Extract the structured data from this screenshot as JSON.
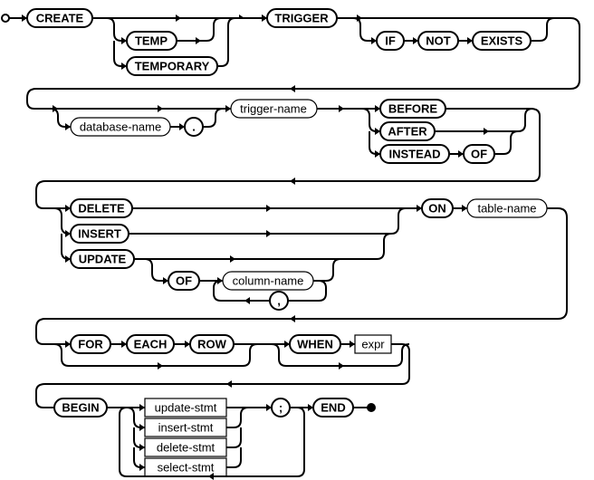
{
  "diagram": {
    "name": "create-trigger-stmt",
    "type": "railroad-syntax-diagram",
    "keywords": {
      "CREATE": "CREATE",
      "TEMP": "TEMP",
      "TEMPORARY": "TEMPORARY",
      "TRIGGER": "TRIGGER",
      "IF": "IF",
      "NOT": "NOT",
      "EXISTS": "EXISTS",
      "BEFORE": "BEFORE",
      "AFTER": "AFTER",
      "INSTEAD": "INSTEAD",
      "OF": "OF",
      "DELETE": "DELETE",
      "INSERT": "INSERT",
      "UPDATE": "UPDATE",
      "ON": "ON",
      "FOR": "FOR",
      "EACH": "EACH",
      "ROW": "ROW",
      "WHEN": "WHEN",
      "BEGIN": "BEGIN",
      "END": "END"
    },
    "punct": {
      "dot": ".",
      "comma": ",",
      "semi": ";"
    },
    "vars": {
      "database_name": "database-name",
      "trigger_name": "trigger-name",
      "table_name": "table-name",
      "column_name": "column-name"
    },
    "refs": {
      "expr": "expr",
      "update_stmt": "update-stmt",
      "insert_stmt": "insert-stmt",
      "delete_stmt": "delete-stmt",
      "select_stmt": "select-stmt"
    }
  }
}
